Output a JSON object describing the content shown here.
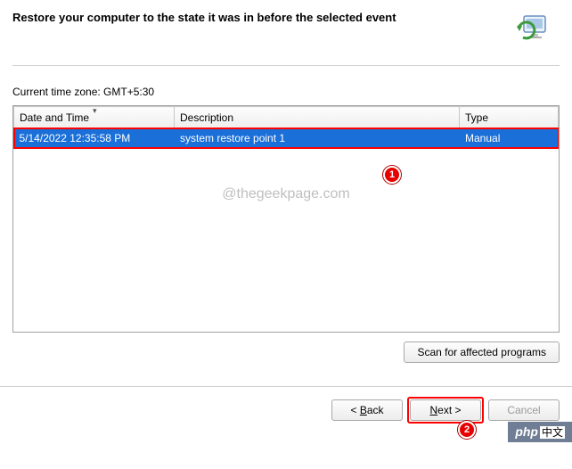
{
  "header": {
    "title": "Restore your computer to the state it was in before the selected event"
  },
  "timezone_label": "Current time zone: GMT+5:30",
  "table": {
    "columns": {
      "date": "Date and Time",
      "desc": "Description",
      "type": "Type"
    },
    "rows": [
      {
        "date": "5/14/2022 12:35:58 PM",
        "desc": "system restore point 1",
        "type": "Manual"
      }
    ]
  },
  "watermark": "@thegeekpage.com",
  "buttons": {
    "scan": "Scan for affected programs",
    "back_pre": "< ",
    "back_u": "B",
    "back_post": "ack",
    "next_u": "N",
    "next_post": "ext >",
    "cancel": "Cancel"
  },
  "annotations": {
    "one": "1",
    "two": "2"
  },
  "php_watermark": {
    "php": "php",
    "cn": "中文"
  }
}
